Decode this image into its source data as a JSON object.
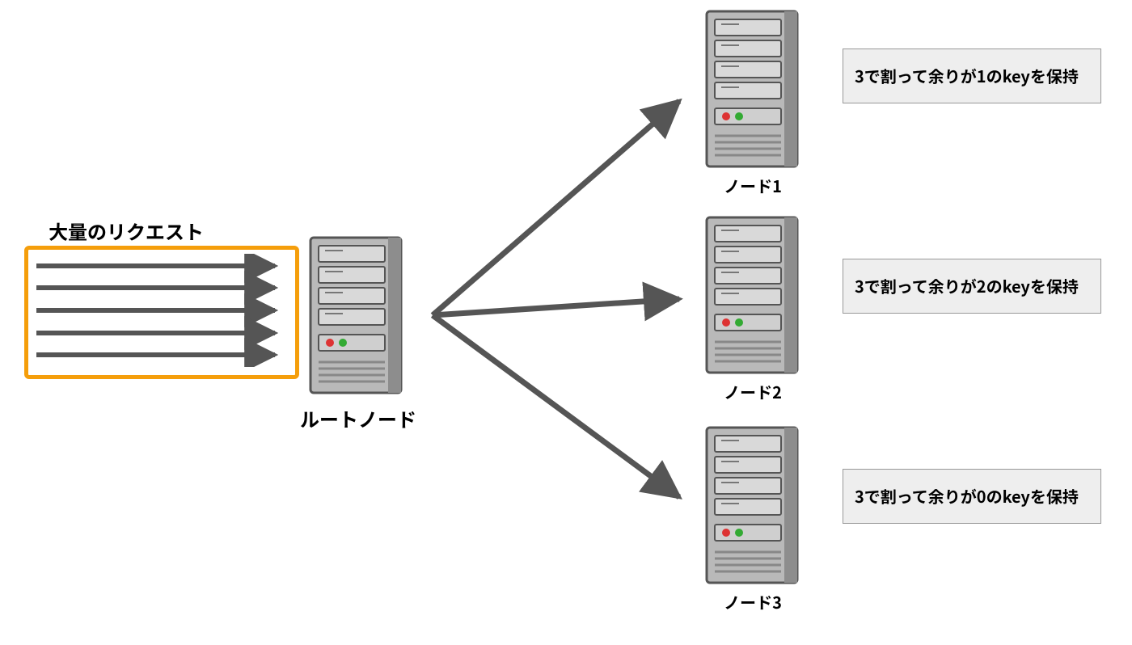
{
  "requests": {
    "title": "大量のリクエスト"
  },
  "root": {
    "title": "ルートノード"
  },
  "nodes": [
    {
      "label": "ノード1",
      "desc": "3で割って余りが1のkeyを保持"
    },
    {
      "label": "ノード2",
      "desc": "3で割って余りが2のkeyを保持"
    },
    {
      "label": "ノード3",
      "desc": "3で割って余りが0のkeyを保持"
    }
  ]
}
